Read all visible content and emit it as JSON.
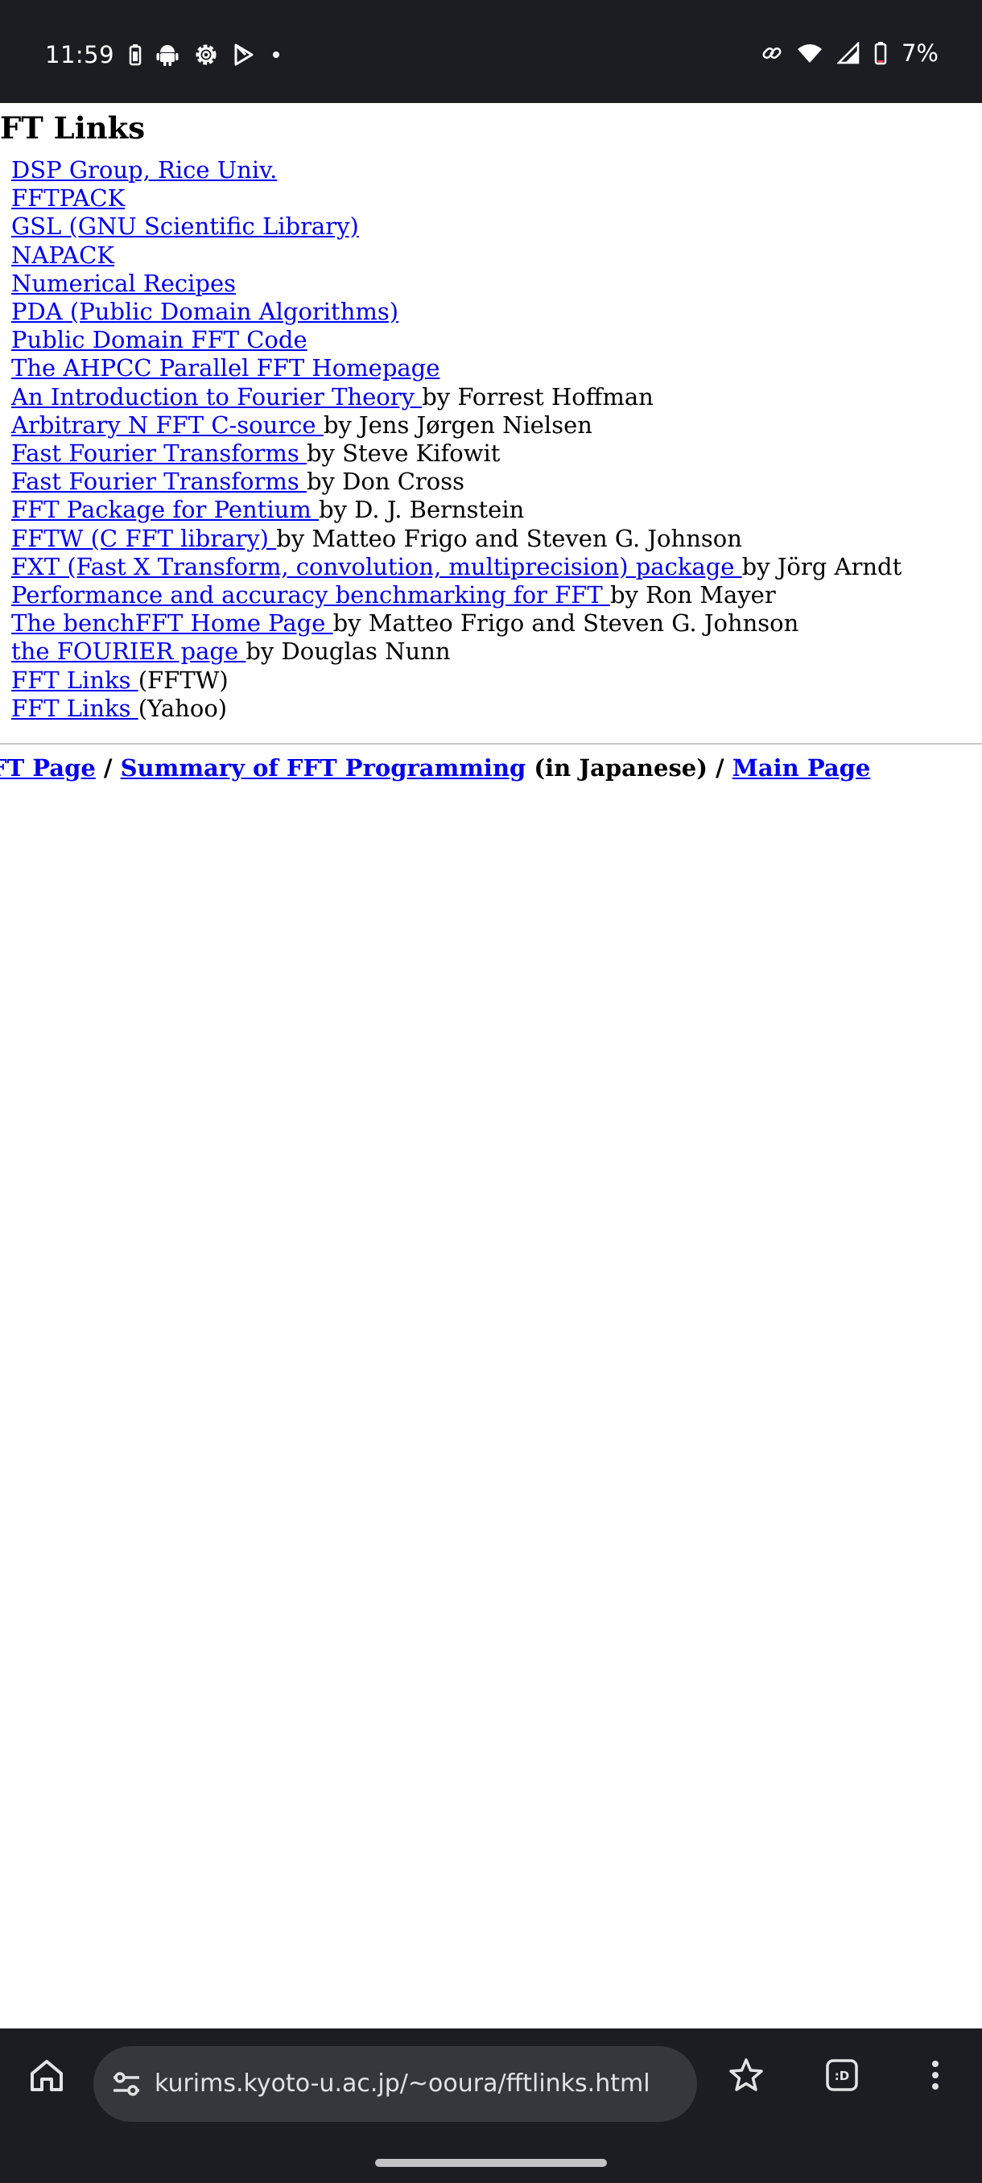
{
  "status_bar": {
    "time": "11:59",
    "battery_percent": "7%",
    "left_icons": [
      "battery-saver-icon",
      "android-icon",
      "settings-gear-icon",
      "play-store-icon",
      "dot-icon"
    ],
    "right_icons": [
      "link-icon",
      "wifi-icon",
      "cellular-signal-icon",
      "battery-icon"
    ]
  },
  "page": {
    "title": "FT Links",
    "links": [
      {
        "text": "DSP Group, Rice Univ.",
        "suffix": ""
      },
      {
        "text": "FFTPACK",
        "suffix": ""
      },
      {
        "text": "GSL (GNU Scientific Library)",
        "suffix": ""
      },
      {
        "text": "NAPACK",
        "suffix": ""
      },
      {
        "text": "Numerical Recipes",
        "suffix": ""
      },
      {
        "text": "PDA (Public Domain Algorithms)",
        "suffix": ""
      },
      {
        "text": "Public Domain FFT Code",
        "suffix": ""
      },
      {
        "text": "The AHPCC Parallel FFT Homepage",
        "suffix": ""
      },
      {
        "text": "An Introduction to Fourier Theory ",
        "suffix": "by Forrest Hoffman"
      },
      {
        "text": "Arbitrary N FFT C-source ",
        "suffix": "by Jens Jørgen Nielsen"
      },
      {
        "text": "Fast Fourier Transforms ",
        "suffix": "by Steve Kifowit"
      },
      {
        "text": "Fast Fourier Transforms ",
        "suffix": "by Don Cross"
      },
      {
        "text": "FFT Package for Pentium ",
        "suffix": "by D. J. Bernstein"
      },
      {
        "text": "FFTW (C FFT library) ",
        "suffix": "by Matteo Frigo and Steven G. Johnson"
      },
      {
        "text": "FXT (Fast X Transform, convolution, multiprecision) package ",
        "suffix": "by Jörg Arndt"
      },
      {
        "text": "Performance and accuracy benchmarking for FFT ",
        "suffix": "by Ron Mayer"
      },
      {
        "text": "The benchFFT Home Page ",
        "suffix": "by Matteo Frigo and Steven G. Johnson"
      },
      {
        "text": "the FOURIER page ",
        "suffix": "by Douglas Nunn"
      },
      {
        "text": "FFT Links ",
        "suffix": "(FFTW)"
      },
      {
        "text": "FFT Links ",
        "suffix": "(Yahoo)"
      }
    ],
    "footer": {
      "link1": "FT Page",
      "sep1": " / ",
      "link2": "Summary of FFT Programming",
      "link2_suffix": " (in Japanese) / ",
      "link3": "Main Page"
    }
  },
  "browser_toolbar": {
    "url": "kurims.kyoto-u.ac.jp/~ooura/fftlinks.html",
    "buttons": [
      "home-icon",
      "site-settings-icon",
      "bookmark-star-icon",
      "tab-switcher-icon",
      "overflow-menu-icon"
    ]
  },
  "colors": {
    "chrome_background": "#1c1d22",
    "omnibox_background": "#36373c",
    "link": "#0000ee",
    "text": "#000000"
  }
}
